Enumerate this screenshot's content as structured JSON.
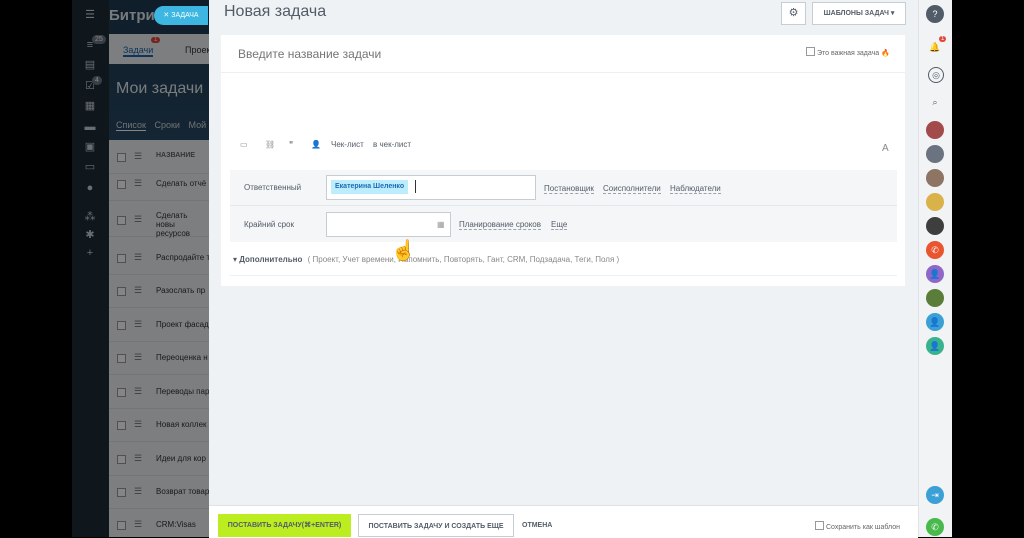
{
  "left_nav": {
    "badges": [
      "25",
      "4"
    ]
  },
  "background_page": {
    "brand": "Битри",
    "tab_tasks": "Задачи",
    "tab_tasks_count": "1",
    "tab_projects": "Проек",
    "page_title": "Мои задачи",
    "view_tabs": [
      "Список",
      "Сроки",
      "Мой"
    ],
    "column_header": "НАЗВАНИЕ",
    "rows": [
      "Сделать отчё",
      "Сделать новы ресурсов",
      "Распродайте т",
      "Разослать пр",
      "Проект фасад",
      "Переоценка н",
      "Переводы пар",
      "Новая коллек",
      "Идеи для кор",
      "Возврат товар",
      "CRM:Visas"
    ]
  },
  "task_chip": "ЗАДАЧА",
  "slider": {
    "title": "Новая задача",
    "templates_button": "ШАБЛОНЫ ЗАДАЧ",
    "task_name_placeholder": "Введите название задачи",
    "important_label": "Это важная задача",
    "toolbar": {
      "checklist": "Чек-лист",
      "to_checklist": "в чек-лист",
      "font": "A"
    },
    "responsible_label": "Ответственный",
    "responsible_value": "Екатерина Шеленко",
    "role_links": [
      "Постановщик",
      "Соисполнители",
      "Наблюдатели"
    ],
    "deadline_label": "Крайний срок",
    "deadline_links": [
      "Планирование сроков",
      "Еще"
    ],
    "more_label": "Дополнительно",
    "more_items": "( Проект, Учет времени, Напомнить, Повторять, Гант, CRM, Подзадача, Теги, Поля )"
  },
  "footer": {
    "submit": "ПОСТАВИТЬ ЗАДАЧУ(⌘+ENTER)",
    "submit_more": "ПОСТАВИТЬ ЗАДАЧУ И СОЗДАТЬ ЕЩЕ",
    "cancel": "ОТМЕНА",
    "save_template": "Сохранить как шаблон"
  },
  "right_panel": {
    "notification_badge": "1"
  }
}
